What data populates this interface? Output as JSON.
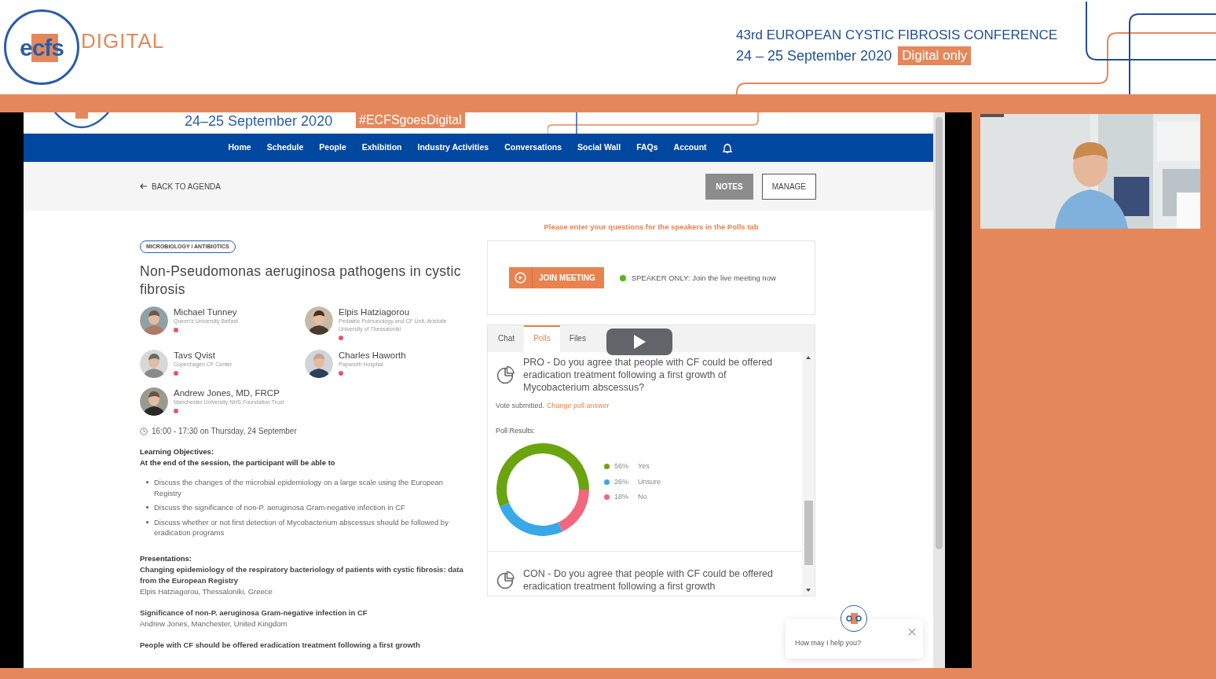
{
  "header": {
    "logo_mark": "ecfs",
    "logo_word": "DIGITAL",
    "conference": "43rd EUROPEAN CYSTIC FIBROSIS CONFERENCE",
    "dates": "24 – 25 September 2020",
    "badge": "Digital only"
  },
  "banner": {
    "dates": "24–25 September 2020",
    "hashtag": "#ECFSgoesDigital"
  },
  "nav": [
    "Home",
    "Schedule",
    "People",
    "Exhibition",
    "Industry Activities",
    "Conversations",
    "Social Wall",
    "FAQs",
    "Account"
  ],
  "back_link": "BACK TO AGENDA",
  "actions": [
    {
      "label": "NOTES",
      "selected": true
    },
    {
      "label": "MANAGE",
      "selected": false
    }
  ],
  "session": {
    "tag": "MICROBIOLOGY / ANTIBIOTICS",
    "title": "Non-Pseudomonas aeruginosa pathogens in cystic fibrosis",
    "speakers": [
      {
        "name": "Michael Tunney",
        "affiliation": "Queen's University Belfast",
        "online": false
      },
      {
        "name": "Elpis Hatziagorou",
        "affiliation": "Pediatric Pulmonology and CF Unit, Aristotle University of Thessaloniki",
        "online": false
      },
      {
        "name": "Tavs Qvist",
        "affiliation": "Copenhagen CF Center",
        "online": false
      },
      {
        "name": "Charles Haworth",
        "affiliation": "Papworth Hospital",
        "online": false
      },
      {
        "name": "Andrew Jones, MD, FRCP",
        "affiliation": "Manchester University NHS Foundation Trust",
        "online": false
      }
    ],
    "time": "16:00 - 17:30 on Thursday, 24 September",
    "objectives_heading": [
      "Learning Objectives:",
      "At the end of the session, the participant will be able to"
    ],
    "objectives": [
      "Discuss the changes of the microbial epidemiology on a large scale using the European Registry",
      "Discuss the significance of non-P. aeruginosa Gram-negative infection in CF",
      "Discuss whether or not first detection of Mycobacterium abscessus should be followed by eradication programs"
    ],
    "presentations_heading": "Presentations:",
    "presentations": [
      {
        "title": "Changing epidemiology of the respiratory bacteriology of patients with cystic fibrosis: data from the European Registry",
        "presenter": "Elpis Hatziagorou, Thessaloniki, Greece"
      },
      {
        "title": "Significance of non-P. aeruginosa Gram-negative infection in CF",
        "presenter": "Andrew Jones, Manchester, United Kingdom"
      },
      {
        "title": "People with CF should be offered eradication treatment following a first growth"
      }
    ]
  },
  "meeting": {
    "notice": "Please enter your questions for the speakers in the Polls tab",
    "join_button": "JOIN MEETING",
    "status": {
      "text": "SPEAKER ONLY: Join the live meeting now",
      "online": true
    }
  },
  "tabs": [
    {
      "label": "Chat",
      "selected": false
    },
    {
      "label": "Polls",
      "selected": true
    },
    {
      "label": "Files",
      "selected": false
    }
  ],
  "polls": [
    {
      "question": "PRO - Do you agree that people with CF could be offered eradication treatment following a first growth of Mycobacterium abscessus?",
      "vote_status": "Vote submitted.",
      "change_link": "Change poll answer",
      "results_label": "Poll Results:",
      "legend": [
        {
          "value": "56%",
          "color": "#6aa40f"
        },
        {
          "value": "26%",
          "color": "#38a9e6"
        },
        {
          "value": "18%",
          "color": "#f2677d"
        }
      ],
      "chart_data": {
        "type": "donut",
        "categories": [
          "Yes",
          "Unsure",
          "No"
        ],
        "values": [
          56,
          26,
          18
        ]
      }
    },
    {
      "question": "CON - Do you agree that people with CF could be offered eradication treatment following a first growth"
    }
  ],
  "chat_widget": {
    "text": "How may I help you?"
  }
}
